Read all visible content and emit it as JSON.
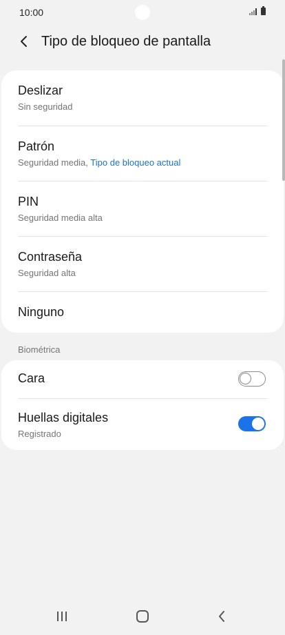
{
  "status_bar": {
    "time": "10:00"
  },
  "header": {
    "title": "Tipo de bloqueo de pantalla"
  },
  "lock_options": [
    {
      "title": "Deslizar",
      "subtitle": "Sin seguridad"
    },
    {
      "title": "Patrón",
      "subtitle": "Seguridad media,",
      "subtitle_accent": "Tipo de bloqueo actual"
    },
    {
      "title": "PIN",
      "subtitle": "Seguridad media alta"
    },
    {
      "title": "Contraseña",
      "subtitle": "Seguridad alta"
    },
    {
      "title": "Ninguno"
    }
  ],
  "biometrics": {
    "section_label": "Biométrica",
    "items": [
      {
        "title": "Cara",
        "enabled": false
      },
      {
        "title": "Huellas digitales",
        "subtitle": "Registrado",
        "enabled": true
      }
    ]
  },
  "colors": {
    "accent": "#1a73e8",
    "link": "#1a73c8",
    "background": "#f2f2f2"
  }
}
